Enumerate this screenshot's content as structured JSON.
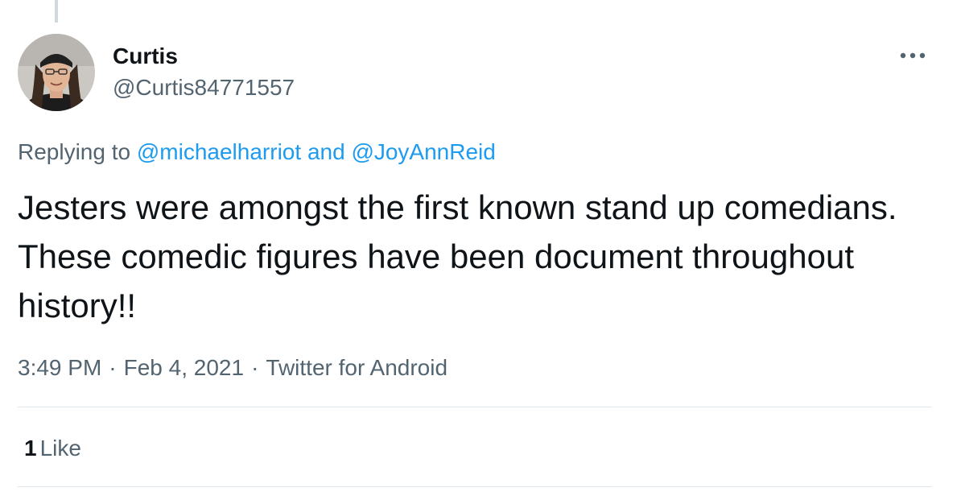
{
  "colors": {
    "text_primary": "#0f1419",
    "text_secondary": "#536471",
    "link": "#1d9bf0",
    "divider": "#e1e8ed"
  },
  "author": {
    "display_name": "Curtis",
    "handle": "@Curtis84771557",
    "avatar": "profile-photo"
  },
  "menu": {
    "icon": "more-horizontal-icon"
  },
  "reply": {
    "prefix": "Replying to",
    "mention_1": "@michaelharriot",
    "conjunction": "and",
    "mention_2": "@JoyAnnReid"
  },
  "tweet": {
    "text": "Jesters were amongst the first known stand up comedians. These comedic figures have been document throughout history!!",
    "time": "3:49 PM",
    "separator": "·",
    "date": "Feb 4, 2021",
    "source": "Twitter for Android"
  },
  "stats": {
    "likes_count": "1",
    "likes_label": "Like"
  }
}
